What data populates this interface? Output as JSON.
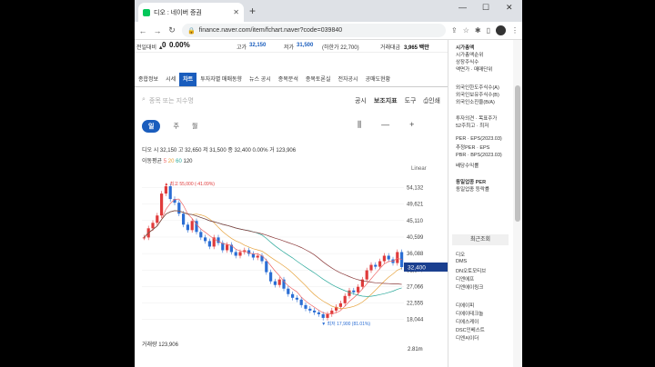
{
  "browser": {
    "tab_title": "디오 : 네이버 증권",
    "url": "finance.naver.com/item/fchart.naver?code=039840",
    "minimize": "—",
    "maximize": "☐",
    "close": "✕"
  },
  "top_info": {
    "prev_label": "전일대비 ▲",
    "change": "0",
    "change_pct": "0.00%",
    "high_label": "고가",
    "high_val": "32,150",
    "low_label": "저가",
    "low_val": "31,500",
    "low_limit": "(하한가 22,700)",
    "trade_label": "거래대금",
    "trade_val": "3,965 백만"
  },
  "tabs": [
    "종합정보",
    "시세",
    "차트",
    "투자자별 매매동향",
    "뉴스 공시",
    "종목분석",
    "종목토론실",
    "전자공시",
    "공매도현황"
  ],
  "search_placeholder": "종목 또는 지수명",
  "tools": [
    "공시",
    "보조지표",
    "도구",
    "인쇄"
  ],
  "periods": [
    "일",
    "주",
    "월"
  ],
  "quote": "디오  시 32,150  고 32,650  저 31,500  종 32,400  0.00%  거 123,906",
  "ma": {
    "label": "이동평균",
    "v5": "5",
    "v20": "20",
    "v60": "60",
    "v120": "120"
  },
  "linear": "Linear",
  "volume": {
    "label": "거래량 123,906",
    "axis": "2.81m"
  },
  "right": {
    "items": [
      "시가총액",
      "시가총액순위",
      "상장주식수",
      "액면가 · 매매단위",
      "외국인한도주식수(A)",
      "외국인보유주식수(B)",
      "외국인소진율(B/A)",
      "투자의견 · 목표주가",
      "52주최고 · 최저",
      "PER · EPS(2023.03)",
      "추정PER · EPS",
      "PBR · BPS(2023.03)",
      "배당수익률",
      "동일업종 PER",
      "동일업종 등락률"
    ],
    "recent_title": "최근조회",
    "recent": [
      "디오",
      "DMS",
      "DN오토모티브",
      "디엔에프",
      "디엔에이링크",
      "디에이피",
      "디에이테크놀",
      "디에스케이",
      "DSC인베스트",
      "디엔씨이더"
    ]
  },
  "chart_data": {
    "type": "line",
    "title": "디오",
    "ylim": [
      15000,
      56000
    ],
    "ticks": [
      54132,
      49621,
      45110,
      40599,
      36088,
      31577,
      27066,
      22555,
      18044
    ],
    "annotations": {
      "max": "최고 55,000 (-41.09%)",
      "min": "최저 17,900 (81.01%)",
      "last": "32,400"
    },
    "series": [
      {
        "name": "디오",
        "values": [
          40500,
          43000,
          44500,
          46500,
          52500,
          54500,
          51000,
          50000,
          47000,
          44000,
          42500,
          45000,
          42000,
          40500,
          39500,
          38000,
          40500,
          39000,
          37000,
          38500,
          36500,
          35500,
          36500,
          37000,
          36000,
          35000,
          35500,
          34000,
          31000,
          28500,
          27500,
          29000,
          26500,
          25000,
          24000,
          23500,
          22000,
          21000,
          20500,
          20000,
          19500,
          18500,
          19500,
          20500,
          21500,
          22500,
          24500,
          26000,
          25500,
          27000,
          29000,
          31500,
          33000,
          32500,
          34000,
          35500,
          34500,
          33500,
          36500,
          32400
        ]
      }
    ],
    "grid": true
  }
}
